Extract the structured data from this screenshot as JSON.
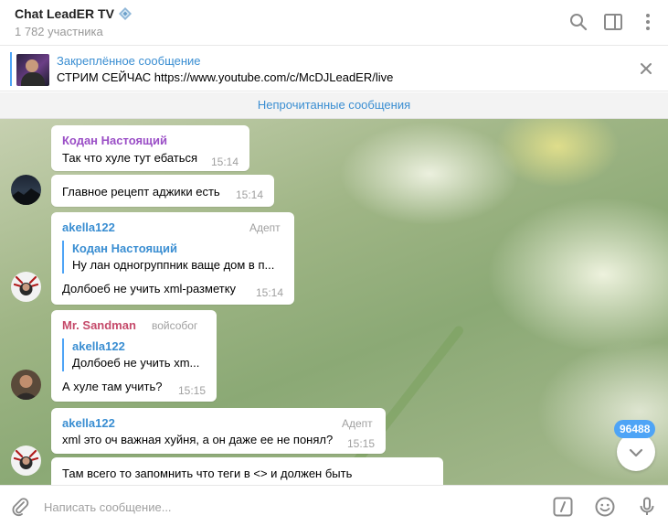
{
  "header": {
    "title": "Chat LeadER TV",
    "title_icon": "diamond-badge-icon",
    "subtitle": "1 782 участника",
    "icons": [
      "search-icon",
      "sidebar-toggle-icon",
      "more-vertical-icon"
    ]
  },
  "pinned": {
    "title": "Закреплённое сообщение",
    "text": "СТРИМ СЕЙЧАС https://www.youtube.com/c/McDJLeadER/live",
    "close_icon": "close-icon"
  },
  "unread_divider": "Непрочитанные сообщения",
  "messages": [
    {
      "author": "Кодан Настоящий",
      "author_color": "#9a4ec6",
      "text": "Так что хуле тут ебаться",
      "time": "15:14"
    },
    {
      "text": "Главное рецепт аджики есть",
      "time": "15:14"
    },
    {
      "author": "akella122",
      "author_color": "#3a8ed2",
      "role": "Адепт",
      "reply": {
        "name": "Кодан Настоящий",
        "text": "Ну лан одногруппник ваще дом в п..."
      },
      "text": "Долбоеб не учить xml-разметку",
      "time": "15:14"
    },
    {
      "author": "Mr. Sandman",
      "author_color": "#c54a6a",
      "role": "войсобог",
      "reply": {
        "name": "akella122",
        "text": "Долбоеб не учить xm..."
      },
      "text": "А хуле там учить?",
      "time": "15:15"
    },
    {
      "author": "akella122",
      "author_color": "#3a8ed2",
      "role": "Адепт",
      "text": "xml это оч важная хуйня, а он даже ее не понял?",
      "time": "15:15"
    },
    {
      "text": "Там всего то запомнить что теги в <> и должен быть"
    }
  ],
  "scroll": {
    "badge": "96488",
    "icon": "chevron-down-icon"
  },
  "composer": {
    "placeholder": "Написать сообщение...",
    "icons": [
      "attach-icon",
      "commands-icon",
      "emoji-icon",
      "microphone-icon"
    ]
  },
  "colors": {
    "accent": "#4ea4f6",
    "link": "#3a8ed2"
  }
}
